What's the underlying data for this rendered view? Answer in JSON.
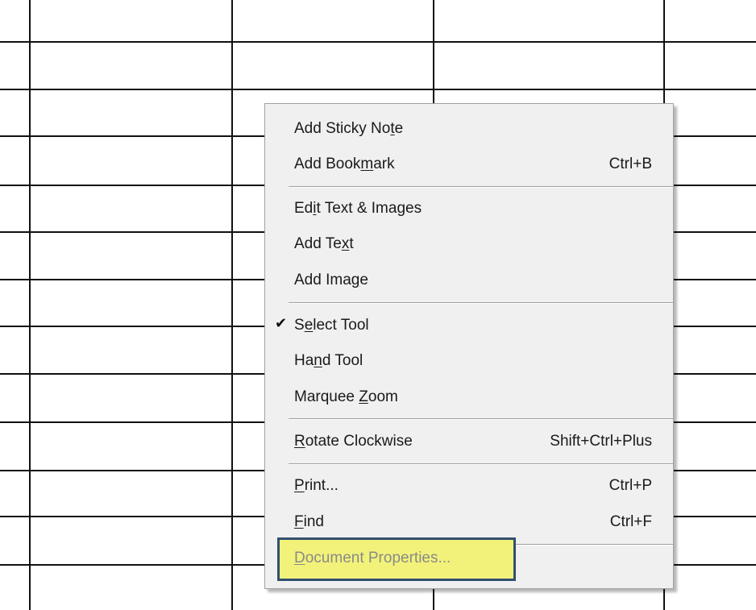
{
  "background": {
    "grid_color": "#111111",
    "page_color": "#ffffff"
  },
  "context_menu": {
    "items": [
      {
        "label_pre": "Add Sticky No",
        "label_ul": "t",
        "label_post": "e",
        "shortcut": ""
      },
      {
        "label_pre": "Add Book",
        "label_ul": "m",
        "label_post": "ark",
        "shortcut": "Ctrl+B"
      },
      {
        "label_pre": "Ed",
        "label_ul": "i",
        "label_post": "t Text & Images",
        "shortcut": ""
      },
      {
        "label_pre": "Add Te",
        "label_ul": "x",
        "label_post": "t",
        "shortcut": ""
      },
      {
        "label_pre": "Add Ima",
        "label_ul": "g",
        "label_post": "e",
        "shortcut": ""
      },
      {
        "label_pre": "S",
        "label_ul": "e",
        "label_post": "lect Tool",
        "shortcut": "",
        "checked": true,
        "check_glyph": "✔"
      },
      {
        "label_pre": "Ha",
        "label_ul": "n",
        "label_post": "d Tool",
        "shortcut": ""
      },
      {
        "label_pre": "Marquee ",
        "label_ul": "Z",
        "label_post": "oom",
        "shortcut": ""
      },
      {
        "label_pre": "",
        "label_ul": "R",
        "label_post": "otate Clockwise",
        "shortcut": "Shift+Ctrl+Plus"
      },
      {
        "label_pre": "",
        "label_ul": "P",
        "label_post": "rint...",
        "shortcut": "Ctrl+P"
      },
      {
        "label_pre": "",
        "label_ul": "F",
        "label_post": "ind",
        "shortcut": "Ctrl+F"
      },
      {
        "label_pre": "",
        "label_ul": "D",
        "label_post": "ocument Properties...",
        "shortcut": "",
        "highlighted": true
      }
    ],
    "highlight_color": "#f2f27a",
    "highlight_border_color": "#2f4f6f"
  }
}
